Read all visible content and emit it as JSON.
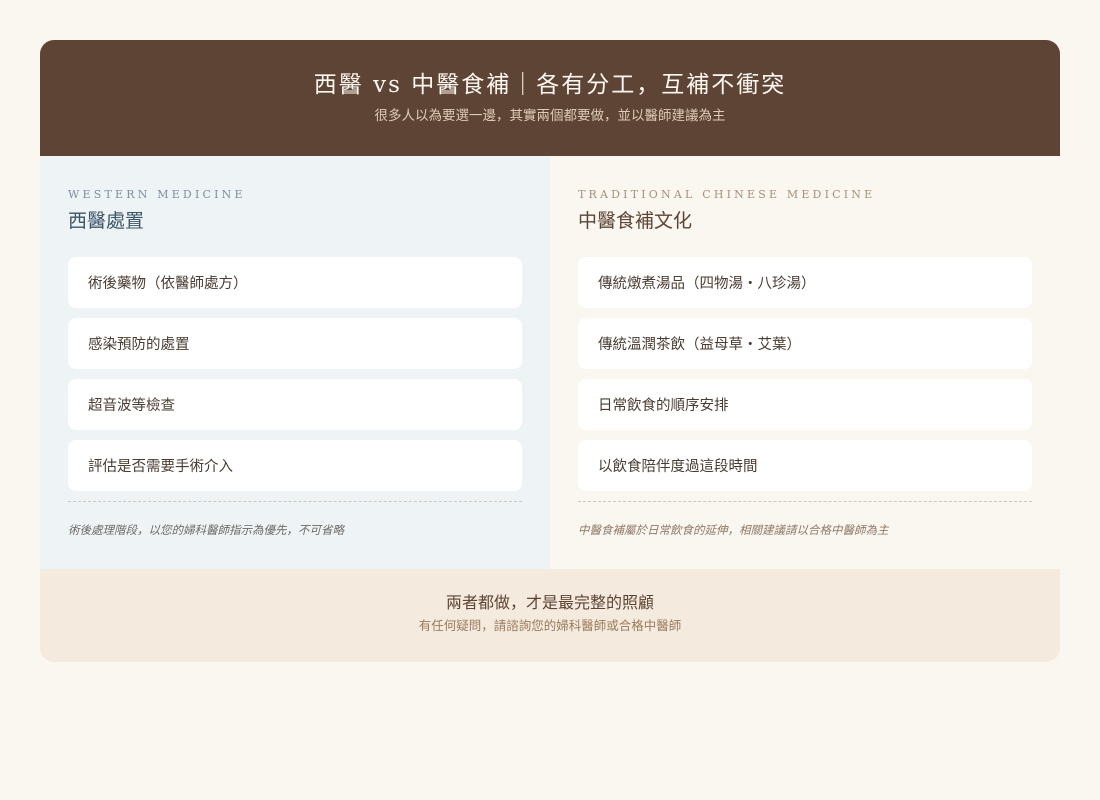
{
  "header": {
    "title": "西醫 vs 中醫食補｜各有分工，互補不衝突",
    "subtitle": "很多人以為要選一邊，其實兩個都要做，並以醫師建議為主"
  },
  "western": {
    "eyebrow": "WESTERN MEDICINE",
    "title": "西醫處置",
    "items": [
      "術後藥物（依醫師處方）",
      "感染預防的處置",
      "超音波等檢查",
      "評估是否需要手術介入"
    ],
    "note": "術後處理階段，以您的婦科醫師指示為優先，不可省略"
  },
  "tcm": {
    "eyebrow": "TRADITIONAL CHINESE MEDICINE",
    "title": "中醫食補文化",
    "items": [
      "傳統燉煮湯品（四物湯・八珍湯）",
      "傳統溫潤茶飲（益母草・艾葉）",
      "日常飲食的順序安排",
      "以飲食陪伴度過這段時間"
    ],
    "note": "中醫食補屬於日常飲食的延伸，相關建議請以合格中醫師為主"
  },
  "footer": {
    "title": "兩者都做，才是最完整的照顧",
    "subtitle": "有任何疑問，請諮詢您的婦科醫師或合格中醫師"
  },
  "colors": {
    "header_bg": "#5e4435",
    "western_bg": "#eef3f6",
    "tcm_bg": "#faf6f0",
    "footer_bg": "#f4eadd"
  }
}
